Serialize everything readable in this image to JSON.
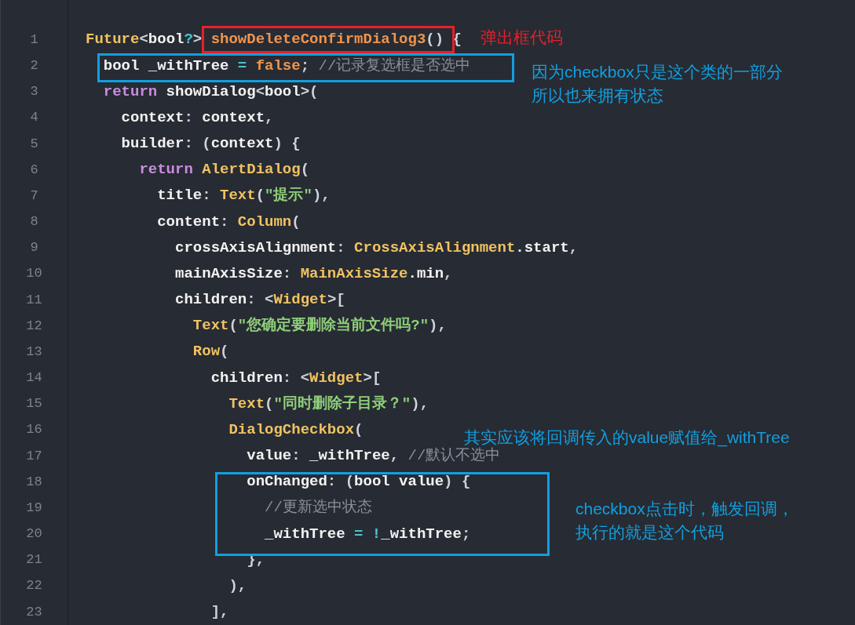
{
  "code_lines": [
    {
      "number": "1",
      "tokens": [
        {
          "kind": "type",
          "text": "Future"
        },
        {
          "kind": "punct",
          "text": "<"
        },
        {
          "kind": "plain",
          "text": "bool"
        },
        {
          "kind": "op",
          "text": "?"
        },
        {
          "kind": "punct",
          "text": "> "
        },
        {
          "kind": "func",
          "text": "showDeleteConfirmDialog3"
        },
        {
          "kind": "punct",
          "text": "() {"
        }
      ]
    },
    {
      "number": "2",
      "tokens": [
        {
          "kind": "plain",
          "text": "  bool _withTree "
        },
        {
          "kind": "op",
          "text": "="
        },
        {
          "kind": "func",
          "text": " false"
        },
        {
          "kind": "punct",
          "text": "; "
        },
        {
          "kind": "comment",
          "text": "//记录复选框是否选中"
        }
      ]
    },
    {
      "number": "3",
      "tokens": [
        {
          "kind": "keyword",
          "text": "  return"
        },
        {
          "kind": "plain",
          "text": " showDialog"
        },
        {
          "kind": "punct",
          "text": "<"
        },
        {
          "kind": "plain",
          "text": "bool"
        },
        {
          "kind": "punct",
          "text": ">("
        }
      ]
    },
    {
      "number": "4",
      "tokens": [
        {
          "kind": "plain",
          "text": "    context"
        },
        {
          "kind": "punct",
          "text": ": "
        },
        {
          "kind": "plain",
          "text": "context"
        },
        {
          "kind": "punct",
          "text": ","
        }
      ]
    },
    {
      "number": "5",
      "tokens": [
        {
          "kind": "plain",
          "text": "    builder"
        },
        {
          "kind": "punct",
          "text": ": ("
        },
        {
          "kind": "plain",
          "text": "context"
        },
        {
          "kind": "punct",
          "text": ") {"
        }
      ]
    },
    {
      "number": "6",
      "tokens": [
        {
          "kind": "keyword",
          "text": "      return"
        },
        {
          "kind": "type",
          "text": " AlertDialog"
        },
        {
          "kind": "punct",
          "text": "("
        }
      ]
    },
    {
      "number": "7",
      "tokens": [
        {
          "kind": "plain",
          "text": "        title"
        },
        {
          "kind": "punct",
          "text": ": "
        },
        {
          "kind": "type",
          "text": "Text"
        },
        {
          "kind": "punct",
          "text": "("
        },
        {
          "kind": "string",
          "text": "\"提示\""
        },
        {
          "kind": "punct",
          "text": "),"
        }
      ]
    },
    {
      "number": "8",
      "tokens": [
        {
          "kind": "plain",
          "text": "        content"
        },
        {
          "kind": "punct",
          "text": ": "
        },
        {
          "kind": "type",
          "text": "Column"
        },
        {
          "kind": "punct",
          "text": "("
        }
      ]
    },
    {
      "number": "9",
      "tokens": [
        {
          "kind": "plain",
          "text": "          crossAxisAlignment"
        },
        {
          "kind": "punct",
          "text": ": "
        },
        {
          "kind": "type",
          "text": "CrossAxisAlignment"
        },
        {
          "kind": "plain",
          "text": ".start"
        },
        {
          "kind": "punct",
          "text": ","
        }
      ]
    },
    {
      "number": "10",
      "tokens": [
        {
          "kind": "plain",
          "text": "          mainAxisSize"
        },
        {
          "kind": "punct",
          "text": ": "
        },
        {
          "kind": "type",
          "text": "MainAxisSize"
        },
        {
          "kind": "plain",
          "text": ".min"
        },
        {
          "kind": "punct",
          "text": ","
        }
      ]
    },
    {
      "number": "11",
      "tokens": [
        {
          "kind": "plain",
          "text": "          children"
        },
        {
          "kind": "punct",
          "text": ": <"
        },
        {
          "kind": "type",
          "text": "Widget"
        },
        {
          "kind": "punct",
          "text": ">["
        }
      ]
    },
    {
      "number": "12",
      "tokens": [
        {
          "kind": "type",
          "text": "            Text"
        },
        {
          "kind": "punct",
          "text": "("
        },
        {
          "kind": "string",
          "text": "\"您确定要删除当前文件吗?\""
        },
        {
          "kind": "punct",
          "text": "),"
        }
      ]
    },
    {
      "number": "13",
      "tokens": [
        {
          "kind": "type",
          "text": "            Row"
        },
        {
          "kind": "punct",
          "text": "("
        }
      ]
    },
    {
      "number": "14",
      "tokens": [
        {
          "kind": "plain",
          "text": "              children"
        },
        {
          "kind": "punct",
          "text": ": <"
        },
        {
          "kind": "type",
          "text": "Widget"
        },
        {
          "kind": "punct",
          "text": ">["
        }
      ]
    },
    {
      "number": "15",
      "tokens": [
        {
          "kind": "type",
          "text": "                Text"
        },
        {
          "kind": "punct",
          "text": "("
        },
        {
          "kind": "string",
          "text": "\"同时删除子目录？\""
        },
        {
          "kind": "punct",
          "text": "),"
        }
      ]
    },
    {
      "number": "16",
      "tokens": [
        {
          "kind": "type",
          "text": "                DialogCheckbox"
        },
        {
          "kind": "punct",
          "text": "("
        }
      ]
    },
    {
      "number": "17",
      "tokens": [
        {
          "kind": "plain",
          "text": "                  value"
        },
        {
          "kind": "punct",
          "text": ": "
        },
        {
          "kind": "plain",
          "text": "_withTree"
        },
        {
          "kind": "punct",
          "text": ", "
        },
        {
          "kind": "comment",
          "text": "//默认不选中"
        }
      ]
    },
    {
      "number": "18",
      "tokens": [
        {
          "kind": "plain",
          "text": "                  onChanged"
        },
        {
          "kind": "punct",
          "text": ": ("
        },
        {
          "kind": "plain",
          "text": "bool value"
        },
        {
          "kind": "punct",
          "text": ") {"
        }
      ]
    },
    {
      "number": "19",
      "tokens": [
        {
          "kind": "comment",
          "text": "                    //更新选中状态"
        }
      ]
    },
    {
      "number": "20",
      "tokens": [
        {
          "kind": "plain",
          "text": "                    _withTree "
        },
        {
          "kind": "op",
          "text": "= !"
        },
        {
          "kind": "plain",
          "text": "_withTree"
        },
        {
          "kind": "punct",
          "text": ";"
        }
      ]
    },
    {
      "number": "21",
      "tokens": [
        {
          "kind": "punct",
          "text": "                  },"
        }
      ]
    },
    {
      "number": "22",
      "tokens": [
        {
          "kind": "punct",
          "text": "                ),"
        }
      ]
    },
    {
      "number": "23",
      "tokens": [
        {
          "kind": "punct",
          "text": "              ],"
        }
      ]
    }
  ],
  "annotations": [
    {
      "kind": "box",
      "color": "#e8202a"
    },
    {
      "kind": "note",
      "color": "#e8202a",
      "lines": [
        "弹出框代码"
      ]
    },
    {
      "kind": "box",
      "color": "#129fe0"
    },
    {
      "kind": "note",
      "color": "#129fe0",
      "lines": [
        "因为checkbox只是这个类的一部分",
        "所以也来拥有状态"
      ]
    },
    {
      "kind": "note",
      "color": "#129fe0",
      "lines": [
        "其实应该将回调传入的value赋值给_withTree"
      ]
    },
    {
      "kind": "box",
      "color": "#129fe0"
    },
    {
      "kind": "note",
      "color": "#129fe0",
      "lines": [
        "checkbox点击时，触发回调，",
        "执行的就是这个代码"
      ]
    }
  ]
}
